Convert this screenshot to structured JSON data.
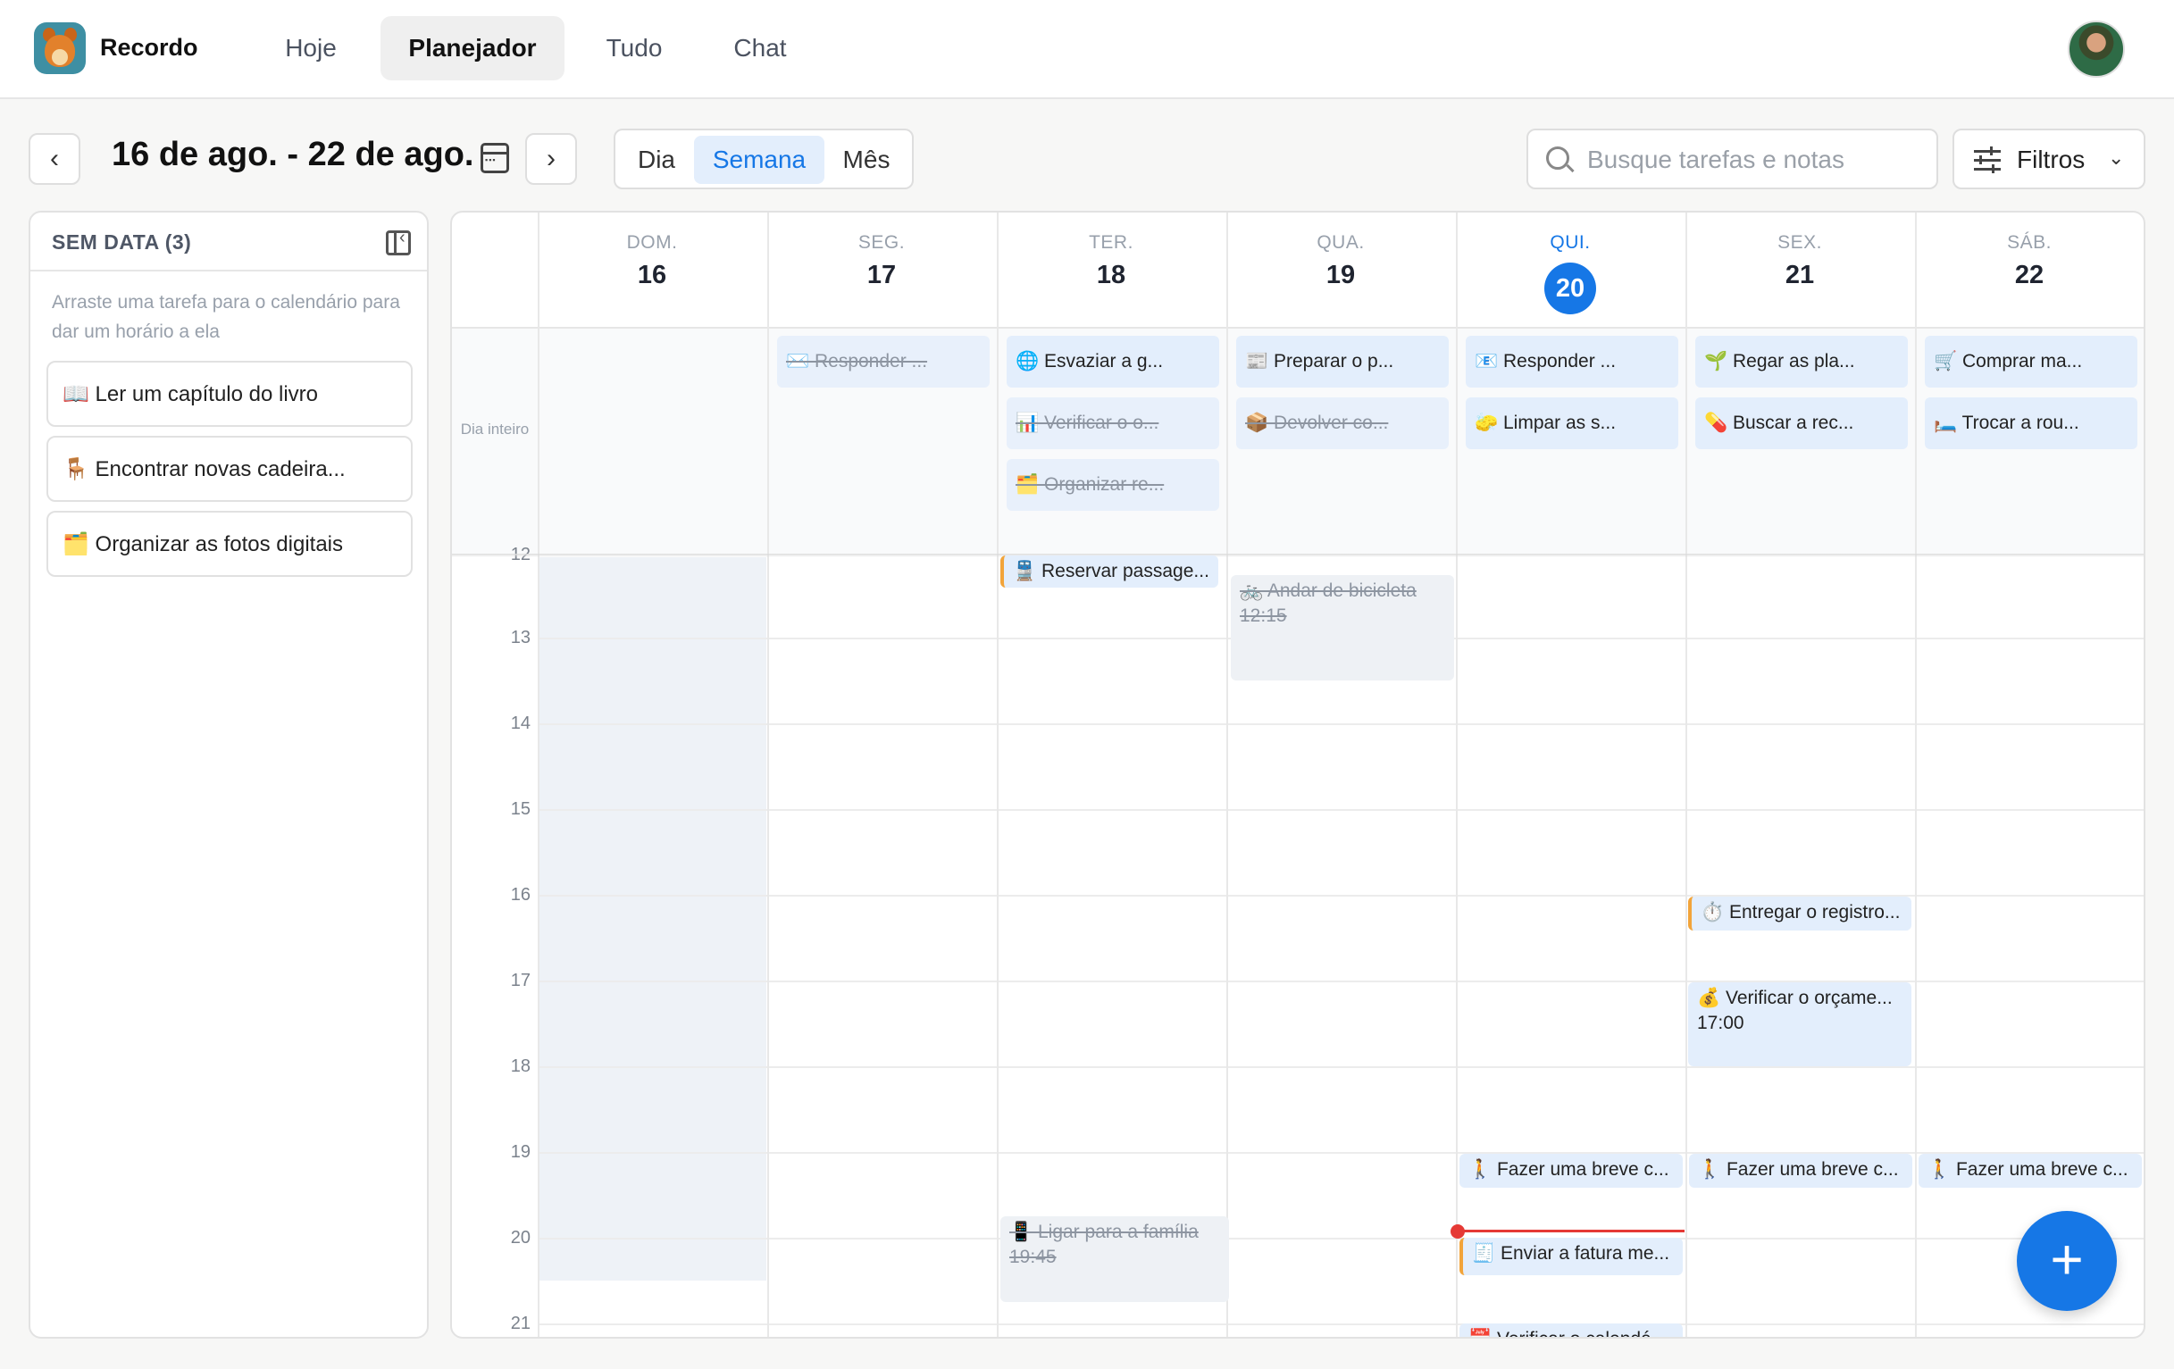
{
  "app": {
    "name": "Recordo"
  },
  "nav": {
    "tabs": [
      "Hoje",
      "Planejador",
      "Tudo",
      "Chat"
    ],
    "active": "Planejador"
  },
  "toolbar": {
    "prev_icon": "‹",
    "next_icon": "›",
    "date_range": "16 de ago. - 22 de ago.",
    "views": [
      "Dia",
      "Semana",
      "Mês"
    ],
    "active_view": "Semana",
    "search_placeholder": "Busque tarefas e notas",
    "filters_label": "Filtros"
  },
  "undated": {
    "title": "SEM DATA (3)",
    "hint": "Arraste uma tarefa para o calendário para dar um horário a ela",
    "tasks": [
      "📖 Ler um capítulo do livro",
      "🪑 Encontrar novas cadeira...",
      "🗂️ Organizar as fotos digitais"
    ]
  },
  "calendar": {
    "allday_label": "Dia inteiro",
    "days": [
      {
        "name": "DOM.",
        "num": "16"
      },
      {
        "name": "SEG.",
        "num": "17"
      },
      {
        "name": "TER.",
        "num": "18"
      },
      {
        "name": "QUA.",
        "num": "19"
      },
      {
        "name": "QUI.",
        "num": "20",
        "today": true
      },
      {
        "name": "SEX.",
        "num": "21"
      },
      {
        "name": "SÁB.",
        "num": "22"
      }
    ],
    "hours": [
      "12",
      "13",
      "14",
      "15",
      "16",
      "17",
      "18",
      "19",
      "20",
      "21"
    ],
    "allday_tasks": [
      {
        "day": 1,
        "text": "✉️ Responder ...",
        "done": true
      },
      {
        "day": 2,
        "text": "🌐 Esvaziar a g...",
        "done": false
      },
      {
        "day": 2,
        "text": "📊 Verificar o o...",
        "done": true
      },
      {
        "day": 2,
        "text": "🗂️ Organizar re...",
        "done": true
      },
      {
        "day": 3,
        "text": "📰 Preparar o p...",
        "done": false
      },
      {
        "day": 3,
        "text": "📦 Devolver co...",
        "done": true
      },
      {
        "day": 4,
        "text": "📧 Responder ...",
        "done": false
      },
      {
        "day": 4,
        "text": "🧽 Limpar as s...",
        "done": false
      },
      {
        "day": 5,
        "text": "🌱 Regar as pla...",
        "done": false
      },
      {
        "day": 5,
        "text": "💊 Buscar a rec...",
        "done": false
      },
      {
        "day": 6,
        "text": "🛒 Comprar ma...",
        "done": false
      },
      {
        "day": 6,
        "text": "🛏️ Trocar a rou...",
        "done": false
      }
    ],
    "timed_events": [
      {
        "day": 2,
        "text": "🚆 Reservar passage...",
        "time": "",
        "done": false,
        "accent": true
      },
      {
        "day": 3,
        "text": "🚲 Andar de bicicleta",
        "time": "12:15",
        "done": true,
        "accent": false
      },
      {
        "day": 5,
        "text": "⏱️ Entregar o registro...",
        "time": "",
        "done": false,
        "accent": true
      },
      {
        "day": 5,
        "text": "💰 Verificar o orçame...",
        "time": "17:00",
        "done": false,
        "accent": false
      },
      {
        "day": 4,
        "text": "🚶 Fazer uma breve c...",
        "time": "",
        "done": false,
        "accent": false
      },
      {
        "day": 5,
        "text": "🚶 Fazer uma breve c...",
        "time": "",
        "done": false,
        "accent": false
      },
      {
        "day": 6,
        "text": "🚶 Fazer uma breve c...",
        "time": "",
        "done": false,
        "accent": false
      },
      {
        "day": 2,
        "text": "📱 Ligar para a família",
        "time": "19:45",
        "done": true,
        "accent": false
      },
      {
        "day": 4,
        "text": "🧾 Enviar a fatura me...",
        "time": "",
        "done": false,
        "accent": true
      },
      {
        "day": 4,
        "text": "📅 Verificar o calendá...",
        "time": "",
        "done": false,
        "accent": false
      }
    ]
  },
  "fab": {
    "label": "+"
  },
  "colors": {
    "accent": "#1677e6",
    "now": "#e53935",
    "event_bg": "#e3eefc",
    "highlight_bar": "#f2a43a"
  }
}
